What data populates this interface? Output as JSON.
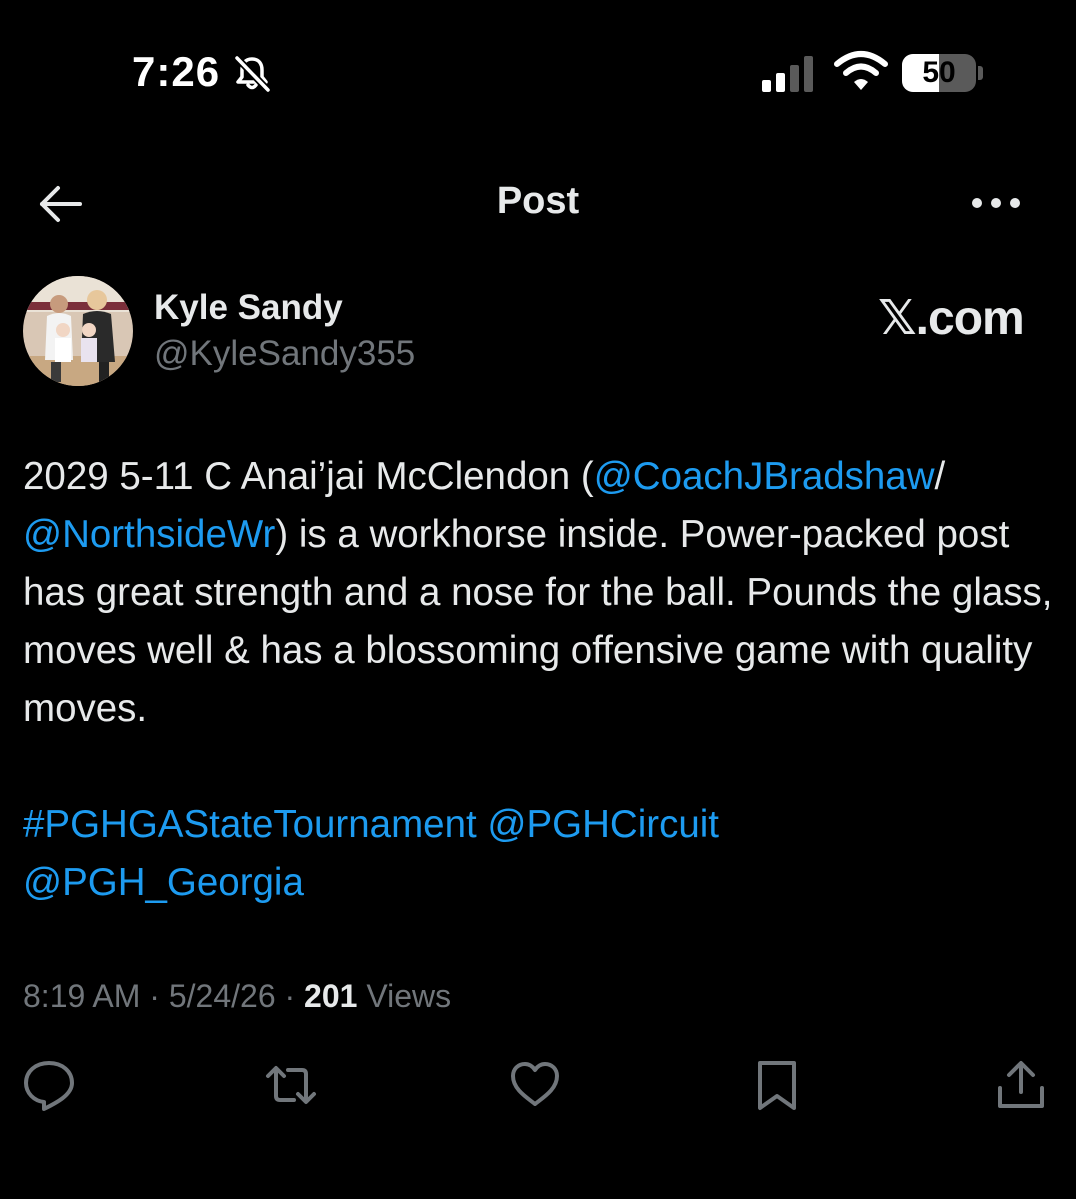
{
  "status_bar": {
    "time": "7:26",
    "battery": "50",
    "battery_level": 0.5
  },
  "nav": {
    "title": "Post"
  },
  "author": {
    "name": "Kyle Sandy",
    "handle": "@KyleSandy355"
  },
  "watermark": "𝕏.com",
  "tweet": {
    "line1_a": "2029 5-11 C Anai’jai McClendon (",
    "mention1": "@CoachJBradshaw",
    "line1_b": "/",
    "mention2": "@NorthsideWr",
    "body_rest": ") is a workhorse inside. Power-packed post has great strength and a nose for the ball. Pounds the glass, moves well & has a blossoming offensive game with quality moves.",
    "hashtag": "#PGHGAStateTournament",
    "mention3": "@PGHCircuit",
    "mention4": "@PGH_Georgia"
  },
  "meta": {
    "time": "8:19 AM",
    "date": "5/24/26",
    "views_count": "201",
    "views_label": "Views",
    "separator": "·"
  },
  "icons": {
    "reply": "reply-icon",
    "repost": "repost-icon",
    "like": "like-icon",
    "bookmark": "bookmark-icon",
    "share": "share-icon",
    "back": "back-arrow-icon",
    "more": "more-icon"
  },
  "colors": {
    "background": "#000000",
    "text": "#e7e9ea",
    "secondary": "#71767b",
    "link": "#1d9bf0"
  }
}
